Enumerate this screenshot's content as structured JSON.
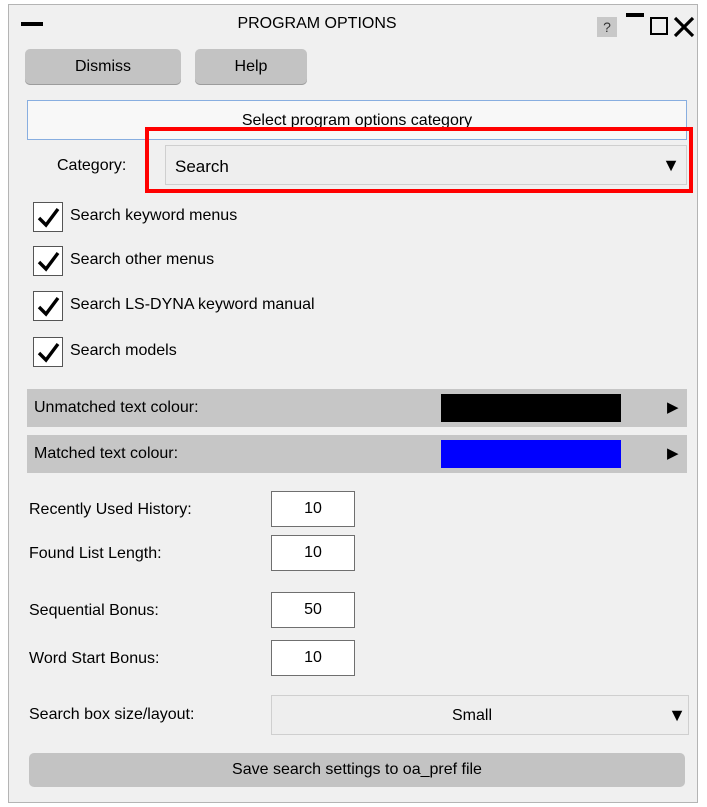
{
  "window": {
    "title": "PROGRAM OPTIONS",
    "help_glyph": "?"
  },
  "toolbar": {
    "dismiss_label": "Dismiss",
    "help_label": "Help"
  },
  "category_section": {
    "header": "Select program options category",
    "label": "Category:",
    "selected": "Search",
    "dropdown_arrow": "▼"
  },
  "checkboxes": [
    {
      "label": "Search keyword menus",
      "checked": true
    },
    {
      "label": "Search other menus",
      "checked": true
    },
    {
      "label": "Search LS-DYNA keyword manual",
      "checked": true
    },
    {
      "label": "Search models",
      "checked": true
    }
  ],
  "colours": {
    "unmatched_label": "Unmatched text colour:",
    "unmatched_value": "#000000",
    "matched_label": "Matched text colour:",
    "matched_value": "#0000ff",
    "arrow": "▶"
  },
  "numeric_fields": [
    {
      "label": "Recently Used History:",
      "value": "10"
    },
    {
      "label": "Found List Length:",
      "value": "10"
    },
    {
      "label": "Sequential Bonus:",
      "value": "50"
    },
    {
      "label": "Word Start Bonus:",
      "value": "10"
    }
  ],
  "layout": {
    "label": "Search box size/layout:",
    "selected": "Small",
    "dropdown_arrow": "▼"
  },
  "save_button_label": "Save search settings to oa_pref file",
  "annotation": {
    "highlight_color": "#ff0000"
  }
}
